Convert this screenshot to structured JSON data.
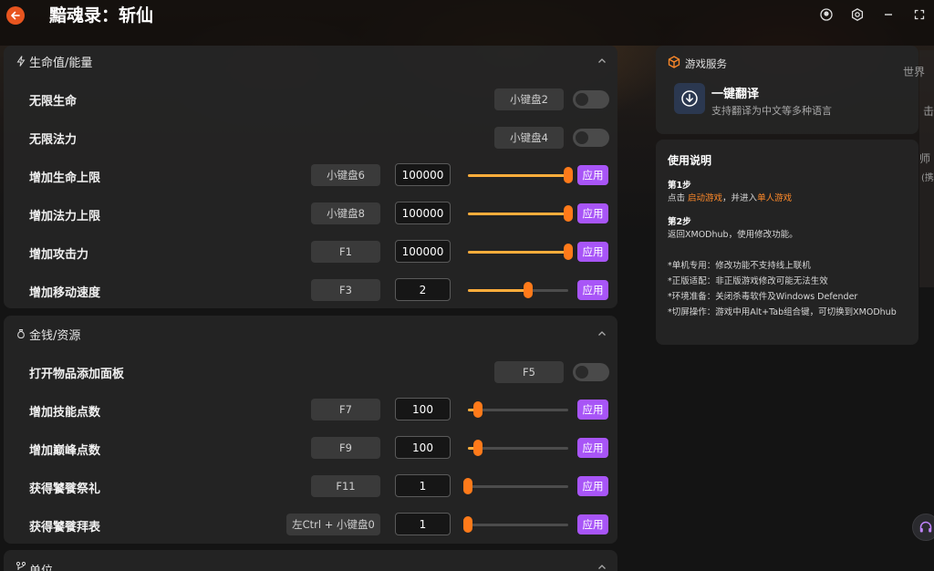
{
  "app": {
    "title": "黯魂录：斩仙"
  },
  "sections": [
    {
      "title": "生命值/能量",
      "rows": [
        {
          "label": "无限生命",
          "hotkey": "小键盘2",
          "type": "toggle",
          "on": false
        },
        {
          "label": "无限法力",
          "hotkey": "小键盘4",
          "type": "toggle",
          "on": false
        },
        {
          "label": "增加生命上限",
          "hotkey": "小键盘6",
          "type": "slider",
          "value": "100000",
          "level": 1.0,
          "apply": "应用"
        },
        {
          "label": "增加法力上限",
          "hotkey": "小键盘8",
          "type": "slider",
          "value": "100000",
          "level": 1.0,
          "apply": "应用"
        },
        {
          "label": "增加攻击力",
          "hotkey": "F1",
          "type": "slider",
          "value": "100000",
          "level": 1.0,
          "apply": "应用"
        },
        {
          "label": "增加移动速度",
          "hotkey": "F3",
          "type": "slider",
          "value": "2",
          "level": 0.6,
          "apply": "应用"
        }
      ]
    },
    {
      "title": "金钱/资源",
      "rows": [
        {
          "label": "打开物品添加面板",
          "hotkey": "F5",
          "type": "toggle",
          "on": false
        },
        {
          "label": "增加技能点数",
          "hotkey": "F7",
          "type": "slider",
          "value": "100",
          "level": 0.1,
          "apply": "应用"
        },
        {
          "label": "增加巅峰点数",
          "hotkey": "F9",
          "type": "slider",
          "value": "100",
          "level": 0.1,
          "apply": "应用"
        },
        {
          "label": "获得饕餮祭礼",
          "hotkey": "F11",
          "type": "slider",
          "value": "1",
          "level": 0.0,
          "apply": "应用"
        },
        {
          "label": "获得饕餮拜表",
          "hotkey": "左Ctrl + 小键盘0",
          "type": "slider",
          "value": "1",
          "level": 0.0,
          "apply": "应用"
        }
      ]
    },
    {
      "title": "单位"
    }
  ],
  "service": {
    "title": "游戏服务",
    "item_name": "一键翻译",
    "item_desc": "支持翻译为中文等多种语言"
  },
  "instructions": {
    "title": "使用说明",
    "step1_label": "第1步",
    "step1_pre": "点击 ",
    "step1_hl1": "启动游戏",
    "step1_mid": "，并进入",
    "step1_hl2": "单人游戏",
    "step2_label": "第2步",
    "step2_text": "返回XMODhub，使用修改功能。",
    "notes": [
      "*单机专用：修改功能不支持线上联机",
      "*正版适配：非正版游戏修改可能无法生效",
      "*环境准备：关闭杀毒软件及Windows Defender",
      "*切屏操作：游戏中用Alt+Tab组合键，可切换到XMODhub"
    ]
  },
  "side_fragments": [
    "世界",
    "击",
    "师",
    "(携"
  ],
  "colors": {
    "accent": "#a855f7",
    "slider": "#ffad3b",
    "thumb": "#ff7a1a",
    "highlight": "#ff8a2a",
    "back": "#e8551f"
  }
}
